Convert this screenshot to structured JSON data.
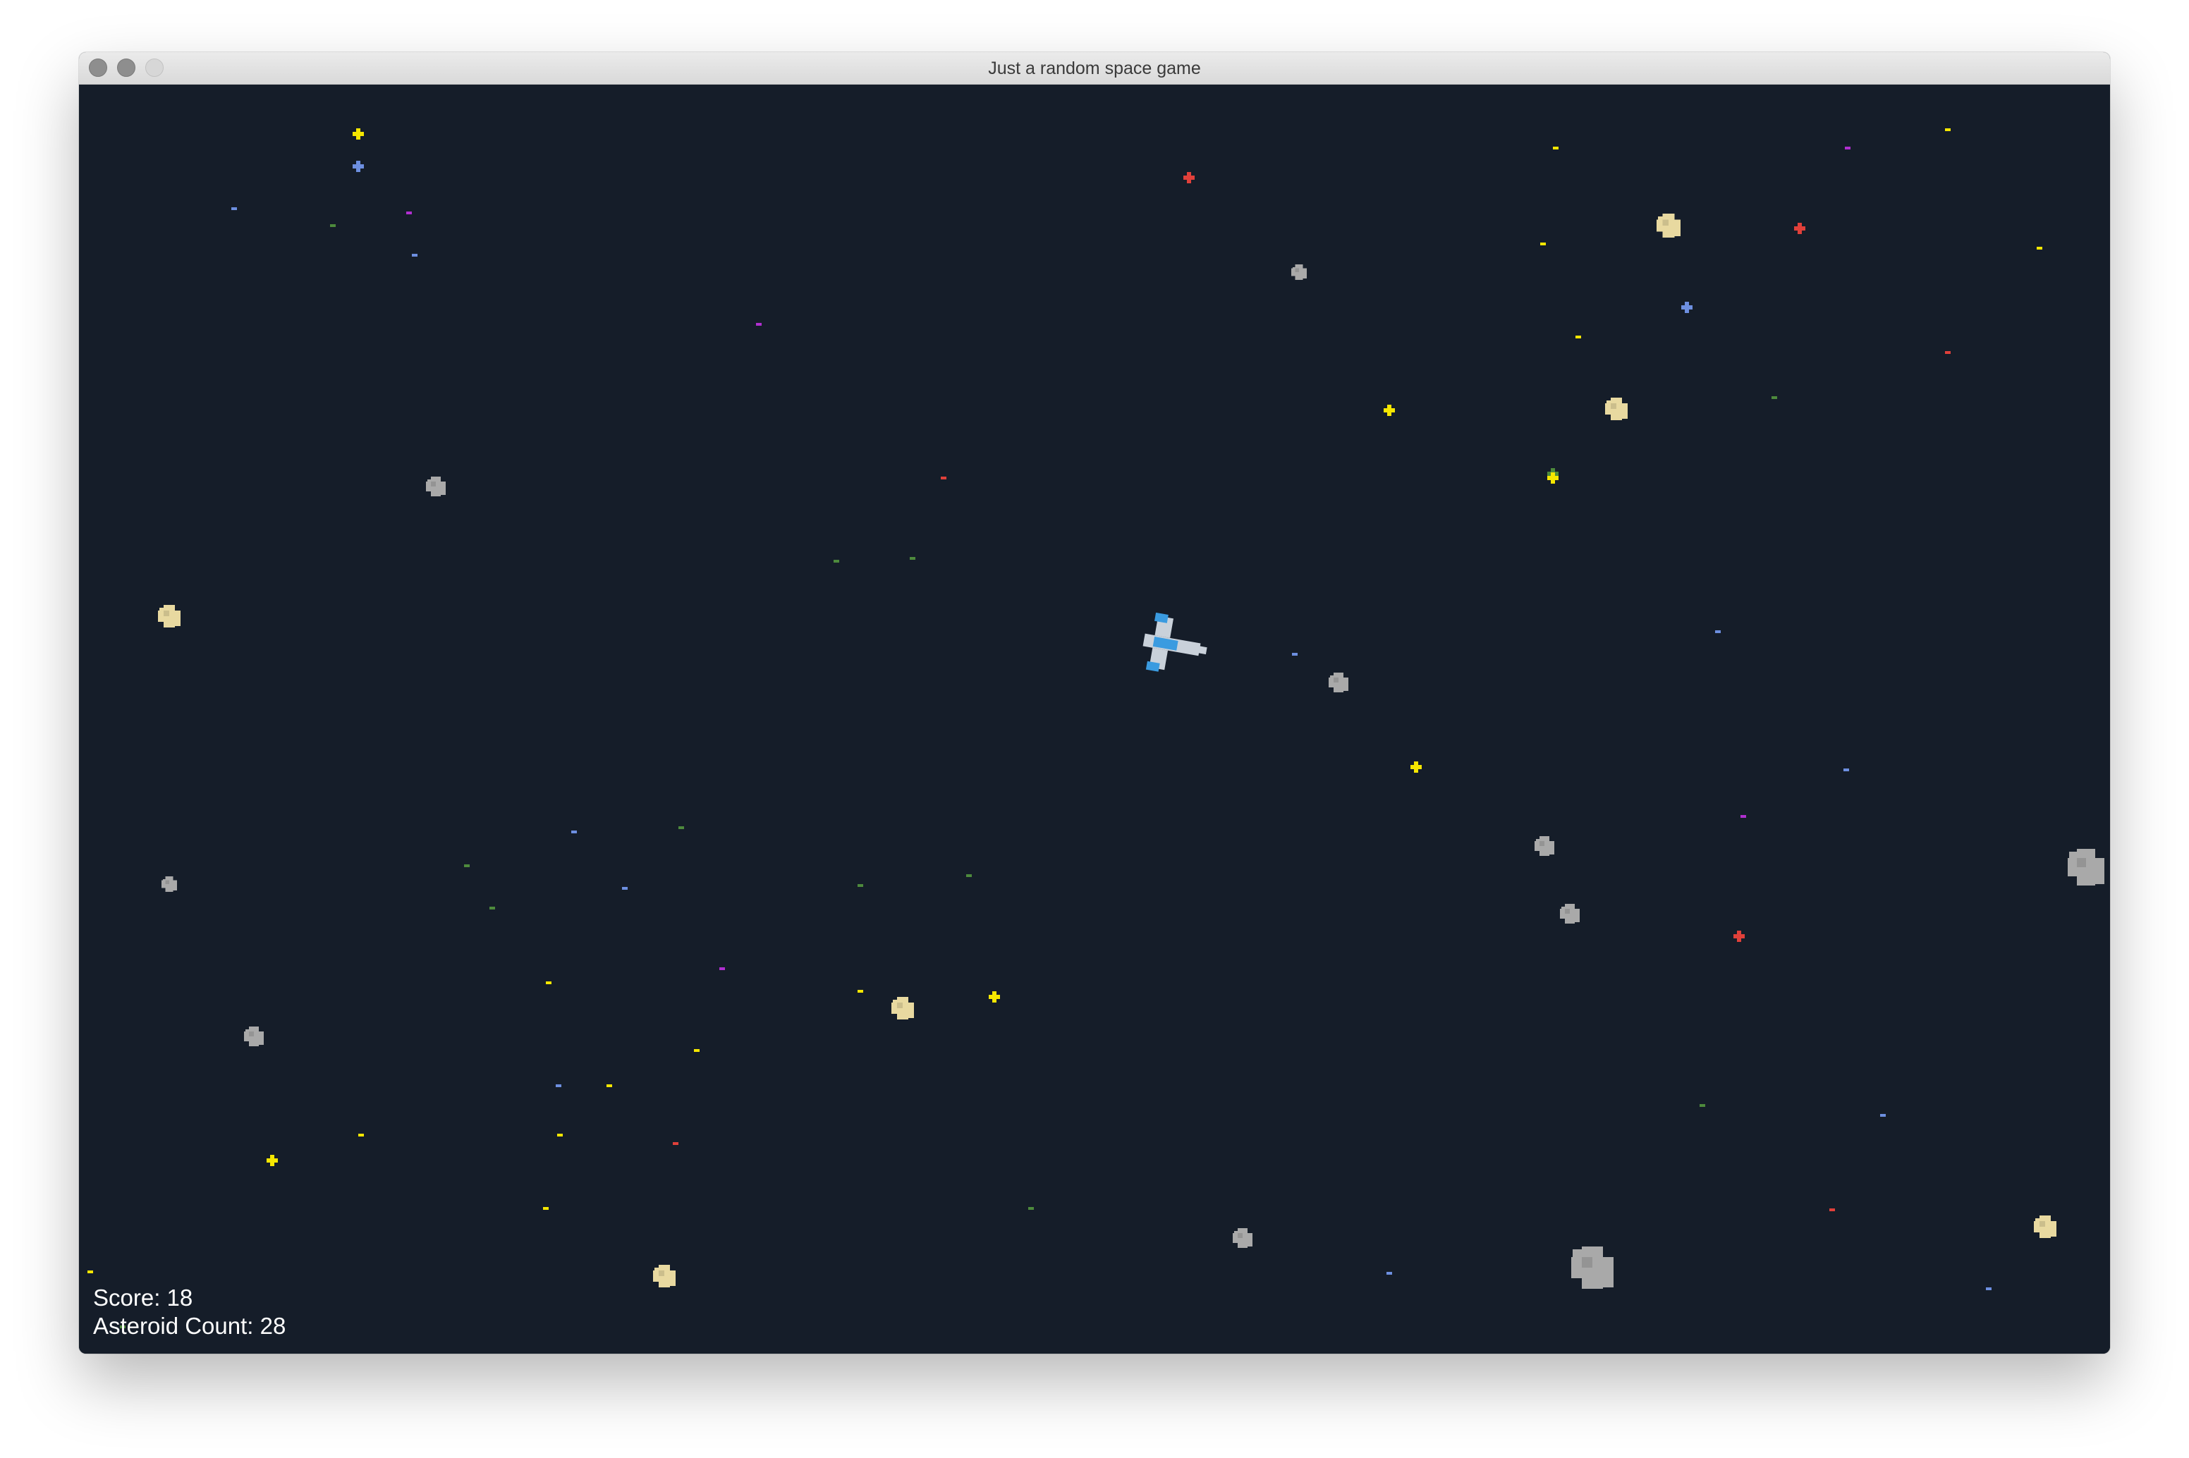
{
  "window": {
    "title": "Just a random space game",
    "traffic_lights": [
      "close",
      "minimize",
      "zoom"
    ]
  },
  "hud": {
    "score_text": "Score: 18",
    "asteroid_count_text": "Asteroid Count: 28"
  },
  "game": {
    "score": 18,
    "asteroid_count": 28,
    "ship": {
      "icon": "spaceship-icon",
      "heading_deg": 10
    }
  },
  "colors": {
    "background": "#151d29",
    "ship_body": "#c9d1da",
    "ship_accent": "#3a9be0",
    "gray_asteroid": "#a9a9a9",
    "gold_asteroid": "#e8d9a0",
    "star_yellow": "#f5e600",
    "star_blue": "#6d8fe0",
    "star_red": "#e0403a",
    "star_purple": "#b02fd0",
    "star_green": "#4d8a3c"
  }
}
